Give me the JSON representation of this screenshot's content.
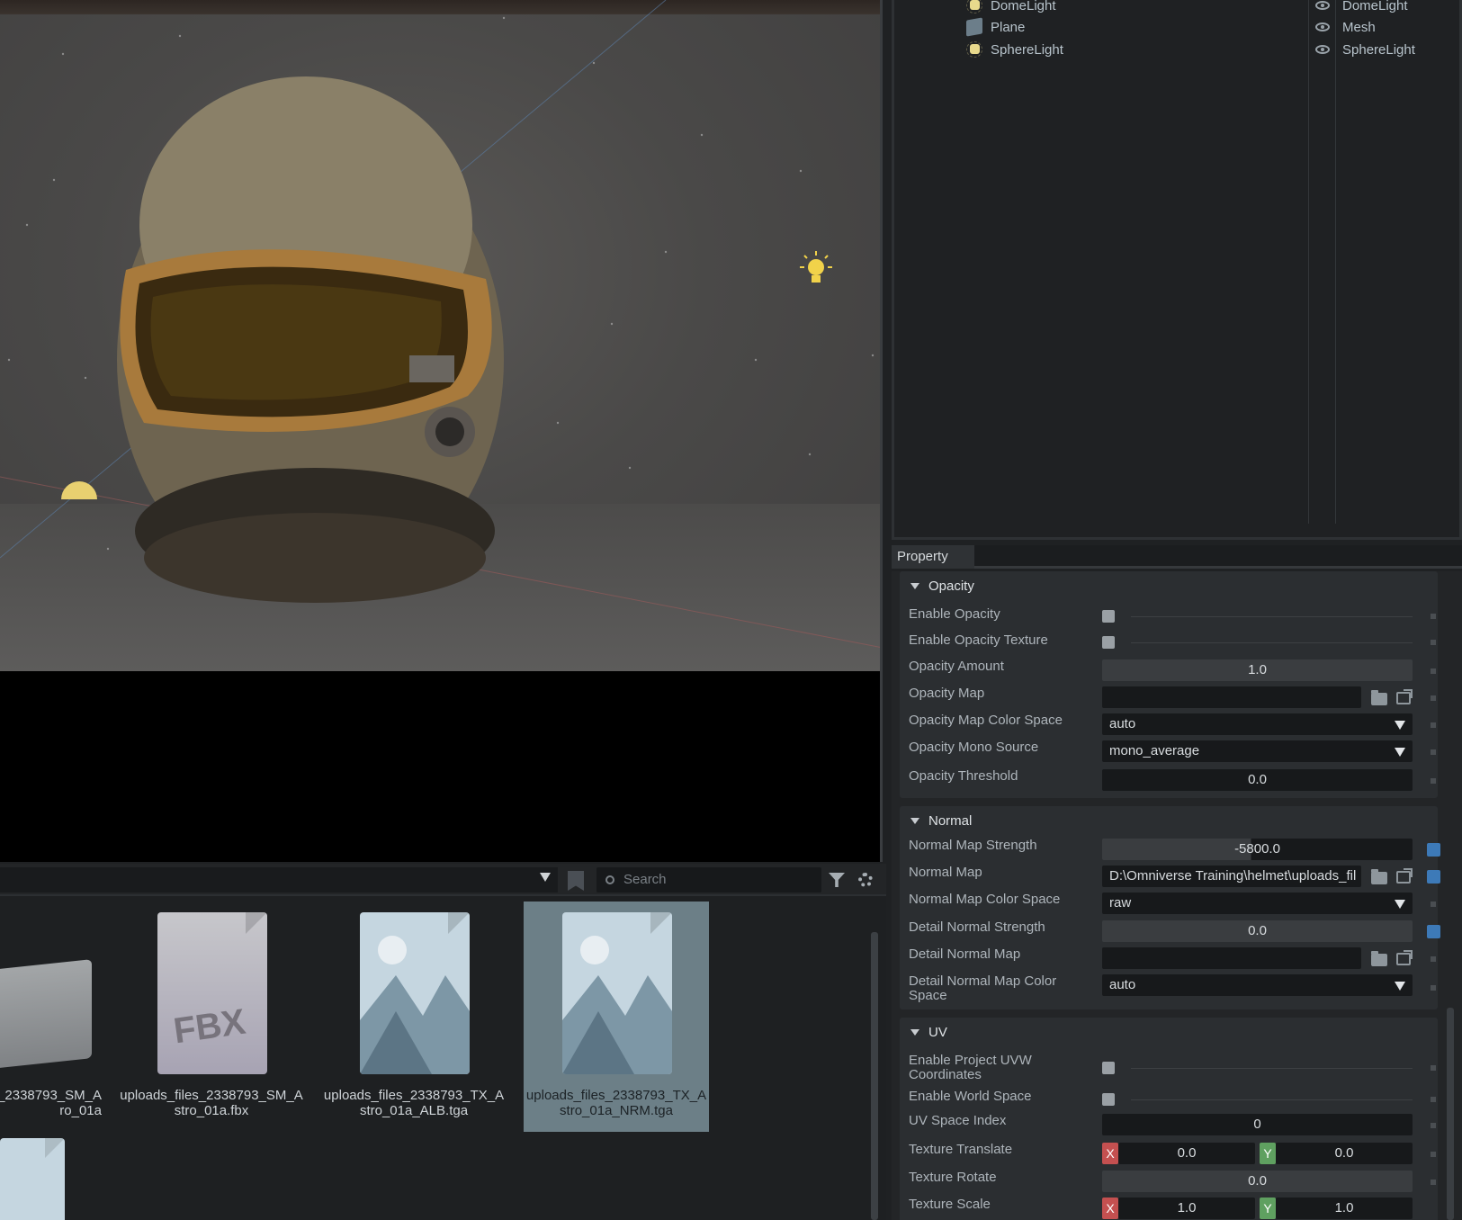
{
  "outliner": {
    "rows": [
      {
        "name": "DomeLight",
        "type": "DomeLight"
      },
      {
        "name": "Plane",
        "type": "Mesh"
      },
      {
        "name": "SphereLight",
        "type": "SphereLight"
      }
    ]
  },
  "property": {
    "tab_label": "Property",
    "opacity": {
      "title": "Opacity",
      "enable_opacity_label": "Enable Opacity",
      "enable_opacity_texture_label": "Enable Opacity Texture",
      "opacity_amount_label": "Opacity Amount",
      "opacity_amount_value": "1.0",
      "opacity_map_label": "Opacity Map",
      "opacity_map_value": "",
      "opacity_map_color_space_label": "Opacity Map Color Space",
      "opacity_map_color_space_value": "auto",
      "opacity_mono_source_label": "Opacity Mono Source",
      "opacity_mono_source_value": "mono_average",
      "opacity_threshold_label": "Opacity Threshold",
      "opacity_threshold_value": "0.0"
    },
    "normal": {
      "title": "Normal",
      "normal_map_strength_label": "Normal Map Strength",
      "normal_map_strength_value": "-5800.0",
      "normal_map_label": "Normal Map",
      "normal_map_value": "D:\\Omniverse Training\\helmet\\uploads_fil",
      "normal_map_color_space_label": "Normal Map Color Space",
      "normal_map_color_space_value": "raw",
      "detail_normal_strength_label": "Detail Normal Strength",
      "detail_normal_strength_value": "0.0",
      "detail_normal_map_label": "Detail Normal Map",
      "detail_normal_map_value": "",
      "detail_normal_map_color_space_label": "Detail Normal Map Color Space",
      "detail_normal_map_color_space_value": "auto"
    },
    "uv": {
      "title": "UV",
      "enable_project_uvw_label": "Enable Project UVW Coordinates",
      "enable_world_space_label": "Enable World Space",
      "uv_space_index_label": "UV Space Index",
      "uv_space_index_value": "0",
      "texture_translate_label": "Texture Translate",
      "texture_translate_x": "0.0",
      "texture_translate_y": "0.0",
      "texture_rotate_label": "Texture Rotate",
      "texture_rotate_value": "0.0",
      "texture_scale_label": "Texture Scale",
      "texture_scale_x": "1.0",
      "texture_scale_y": "1.0",
      "x_badge": "X",
      "y_badge": "Y"
    }
  },
  "browser": {
    "search_placeholder": "Search",
    "files": [
      {
        "name": "_2338793_SM_A\nro_01a",
        "kind": "folder"
      },
      {
        "name": "uploads_files_2338793_SM_A\nstro_01a.fbx",
        "kind": "fbx",
        "badge": "FBX"
      },
      {
        "name": "uploads_files_2338793_TX_A\nstro_01a_ALB.tga",
        "kind": "image"
      },
      {
        "name": "uploads_files_2338793_TX_A\nstro_01a_NRM.tga",
        "kind": "image",
        "selected": true
      }
    ]
  },
  "colors": {
    "accent_blue": "#3d7ab8",
    "selection": "#6c7f87",
    "x_axis": "#c45050",
    "y_axis": "#5fa060",
    "light_icon": "#e8d98c"
  }
}
